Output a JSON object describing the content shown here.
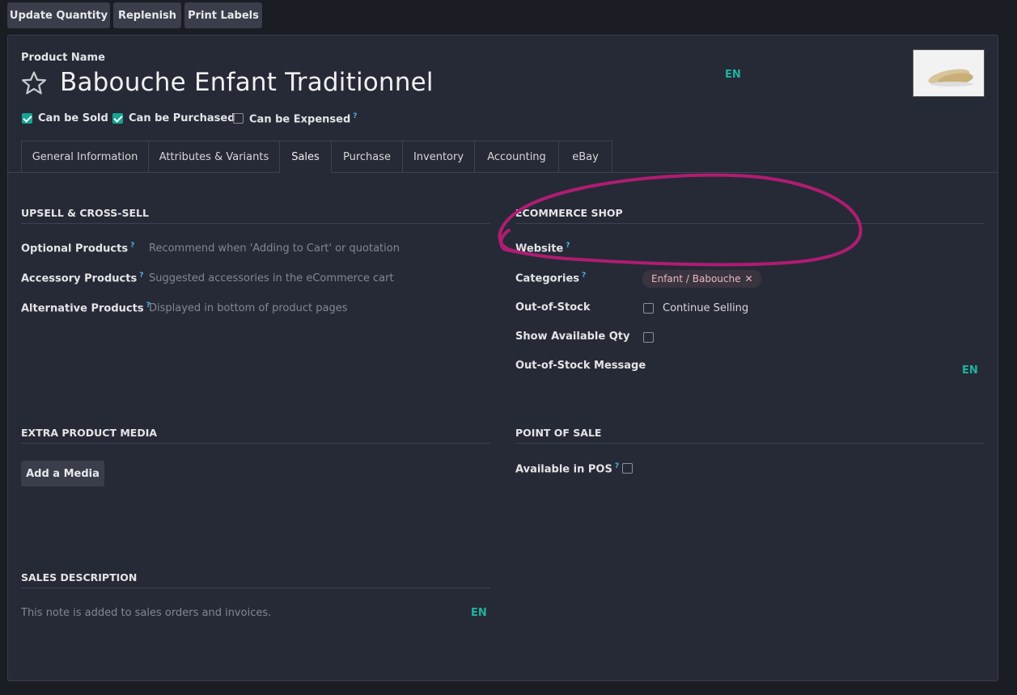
{
  "toolbar": {
    "update_quantity": "Update Quantity",
    "replenish": "Replenish",
    "print_labels": "Print Labels"
  },
  "product": {
    "name_label": "Product Name",
    "name": "Babouche Enfant Traditionnel",
    "lang": "EN",
    "can_be_sold": "Can be Sold",
    "can_be_sold_checked": true,
    "can_be_purchased": "Can be Purchased",
    "can_be_purchased_checked": true,
    "can_be_expensed": "Can be Expensed",
    "can_be_expensed_checked": false,
    "help_mark": "?"
  },
  "tabs": [
    {
      "label": "General Information",
      "active": false
    },
    {
      "label": "Attributes & Variants",
      "active": false
    },
    {
      "label": "Sales",
      "active": true
    },
    {
      "label": "Purchase",
      "active": false
    },
    {
      "label": "Inventory",
      "active": false
    },
    {
      "label": "Accounting",
      "active": false
    },
    {
      "label": "eBay",
      "active": false
    }
  ],
  "upsell": {
    "title": "UPSELL & CROSS-SELL",
    "optional_label": "Optional Products",
    "optional_placeholder": "Recommend when 'Adding to Cart' or quotation",
    "accessory_label": "Accessory Products",
    "accessory_placeholder": "Suggested accessories in the eCommerce cart",
    "alternative_label": "Alternative Products",
    "alternative_placeholder": "Displayed in bottom of product pages"
  },
  "ecommerce": {
    "title": "ECOMMERCE SHOP",
    "website_label": "Website",
    "categories_label": "Categories",
    "category_tag": "Enfant / Babouche",
    "tag_remove": "✕",
    "out_of_stock_label": "Out-of-Stock",
    "continue_selling": "Continue Selling",
    "show_qty_label": "Show Available Qty",
    "oos_message_label": "Out-of-Stock Message",
    "lang": "EN",
    "annotation_color": "#b01c72"
  },
  "media": {
    "title": "EXTRA PRODUCT MEDIA",
    "add_button": "Add a Media"
  },
  "pos": {
    "title": "POINT OF SALE",
    "available_label": "Available in POS"
  },
  "sales_description": {
    "title": "SALES DESCRIPTION",
    "placeholder": "This note is added to sales orders and invoices.",
    "lang": "EN"
  },
  "colors": {
    "accent": "#16a596",
    "background": "#1a1d24",
    "sheet": "#262a36"
  }
}
